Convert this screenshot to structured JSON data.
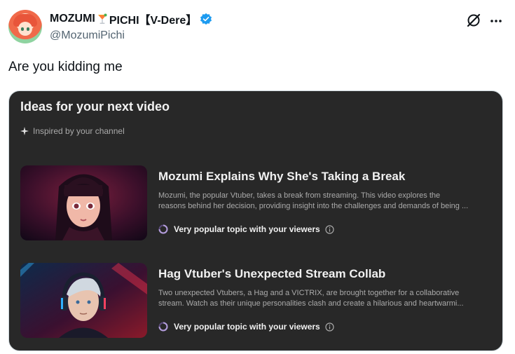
{
  "tweet": {
    "author": {
      "display_name_part1": "MOZUMI",
      "display_name_emoji": "cocktail-emoji",
      "display_name_part2": "PICHI【V-Dere】",
      "verified": true,
      "handle": "@MozumiPichi"
    },
    "text": "Are you kidding me",
    "actions": [
      "grok-icon",
      "more-options-icon"
    ]
  },
  "card": {
    "title": "Ideas for your next video",
    "subtitle": "Inspired by your channel",
    "ideas": [
      {
        "title": "Mozumi Explains Why She's Taking a Break",
        "description_line1": "Mozumi, the popular Vtuber, takes a break from streaming. This video explores the",
        "description_line2": "reasons behind her decision, providing insight into the challenges and demands of being ...",
        "badge": "Very popular topic with your viewers",
        "thumbnail": "anime-girl-portrait"
      },
      {
        "title": "Hag Vtuber's Unexpected Stream Collab",
        "description_line1": "Two unexpected Vtubers, a Hag and a VICTRIX, are brought together for a collaborative",
        "description_line2": "stream. Watch as their unique personalities clash and create a hilarious and heartwarmi...",
        "badge": "Very popular topic with your viewers",
        "thumbnail": "headphones-boy-portrait"
      }
    ]
  },
  "colors": {
    "card_bg": "#282828",
    "accent_ring": "#b39ddb",
    "verified": "#1d9bf0",
    "text_primary": "#0f1419",
    "text_secondary": "#536471"
  }
}
